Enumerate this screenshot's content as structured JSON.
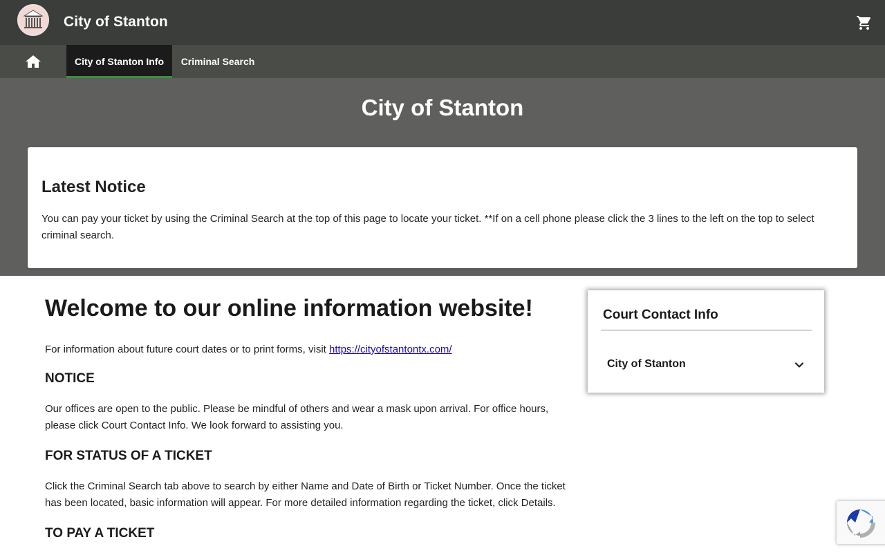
{
  "header": {
    "site_title": "City of Stanton",
    "logo_icon": "courthouse-icon",
    "cart_icon": "cart-icon"
  },
  "nav": {
    "home_icon": "home-icon",
    "tabs": [
      {
        "label": "City of Stanton Info",
        "active": true
      },
      {
        "label": "Criminal Search",
        "active": false
      }
    ]
  },
  "hero": {
    "title": "City of Stanton",
    "notice_title": "Latest Notice",
    "notice_body": "You can pay your ticket by using the Criminal Search at the top of this page to locate your ticket. **If on a cell phone please click the 3 lines to the left on the top to select criminal search."
  },
  "main": {
    "welcome": "Welcome to our online information website!",
    "intro_prefix": "For information about future court dates or to print forms, visit ",
    "intro_link": "https://cityofstantontx.com/",
    "sections": [
      {
        "heading": "NOTICE",
        "body": "Our offices are open to the public. Please be mindful of others and wear a mask upon arrival. For office hours, please click Court Contact Info. We look forward to assisting you."
      },
      {
        "heading": "FOR STATUS OF A TICKET",
        "body": "Click the Criminal Search tab above to search by either Name and Date of Birth or Ticket Number. Once the ticket has been located, basic information will appear. For more detailed information regarding the ticket, click Details."
      },
      {
        "heading": "TO PAY A TICKET",
        "body": ""
      }
    ]
  },
  "sidebar": {
    "title": "Court Contact Info",
    "accordion_label": "City of Stanton",
    "chevron_icon": "chevron-down-icon"
  },
  "recaptcha": {
    "icon": "recaptcha-icon"
  },
  "colors": {
    "topbar": "#3b3d3a",
    "navbar": "#4a4c48",
    "active_tab": "#1b1b1b",
    "active_underline": "#3e8f3e",
    "hero": "#5f605e",
    "link": "#1a0dab"
  }
}
